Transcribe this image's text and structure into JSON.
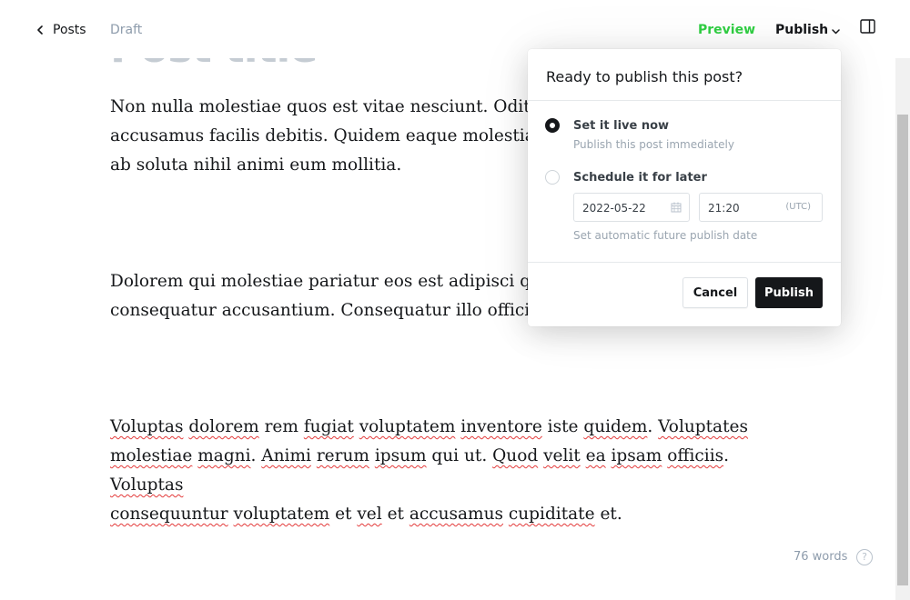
{
  "header": {
    "back_label": "Posts",
    "status": "Draft",
    "preview_label": "Preview",
    "publish_label": "Publish"
  },
  "post": {
    "title": "Post title",
    "paragraphs": [
      {
        "lines": [
          "Non nulla molestiae quos est vitae nesciunt. Odit ea",
          "accusamus facilis debitis. Quidem eaque molestiae i",
          "ab soluta nihil animi eum mollitia."
        ]
      },
      {
        "lines": [
          "Dolorem qui molestiae pariatur eos est adipisci qui.",
          "consequatur accusantium. Consequatur illo officia."
        ]
      }
    ],
    "paragraph3": {
      "w01": "Voluptas",
      "w02": "dolorem",
      "w03": "rem",
      "w04": "fugiat",
      "w05": "voluptatem",
      "w06": "inventore",
      "w07": "iste",
      "w08": "quidem",
      "w09": "Voluptates",
      "w10": "molestiae",
      "w11": "magni",
      "w12": "Animi",
      "w13": "rerum",
      "w14": "ipsum",
      "w15": "qui ut.",
      "w16": "Quod",
      "w17": "velit",
      "w18": "ea",
      "w19": "ipsam",
      "w20": "officiis",
      "w21": "Voluptas",
      "w22": "consequuntur",
      "w23": "voluptatem",
      "w24": "et",
      "w25": "vel",
      "w26": "et",
      "w27": "accusamus",
      "w28": "cupiditate",
      "w29": "et."
    },
    "word_count": "76 words",
    "help_glyph": "?"
  },
  "publish_menu": {
    "title": "Ready to publish this post?",
    "option_now": {
      "label": "Set it live now",
      "description": "Publish this post immediately",
      "selected": true
    },
    "option_later": {
      "label": "Schedule it for later",
      "date_value": "2022-05-22",
      "time_value": "21:20",
      "timezone": "(UTC)",
      "description": "Set automatic future publish date",
      "selected": false
    },
    "cancel_label": "Cancel",
    "publish_label": "Publish"
  },
  "icons": {
    "back": "chevron-left-icon",
    "publish_menu": "chevron-down-icon",
    "sidebar": "sidebar-toggle-icon",
    "calendar": "calendar-icon",
    "help": "help-icon"
  },
  "colors": {
    "preview": "#30cf43",
    "primary_button": "#15171a",
    "muted_text": "#8e9cac",
    "spell_error": "#e33a3a"
  }
}
